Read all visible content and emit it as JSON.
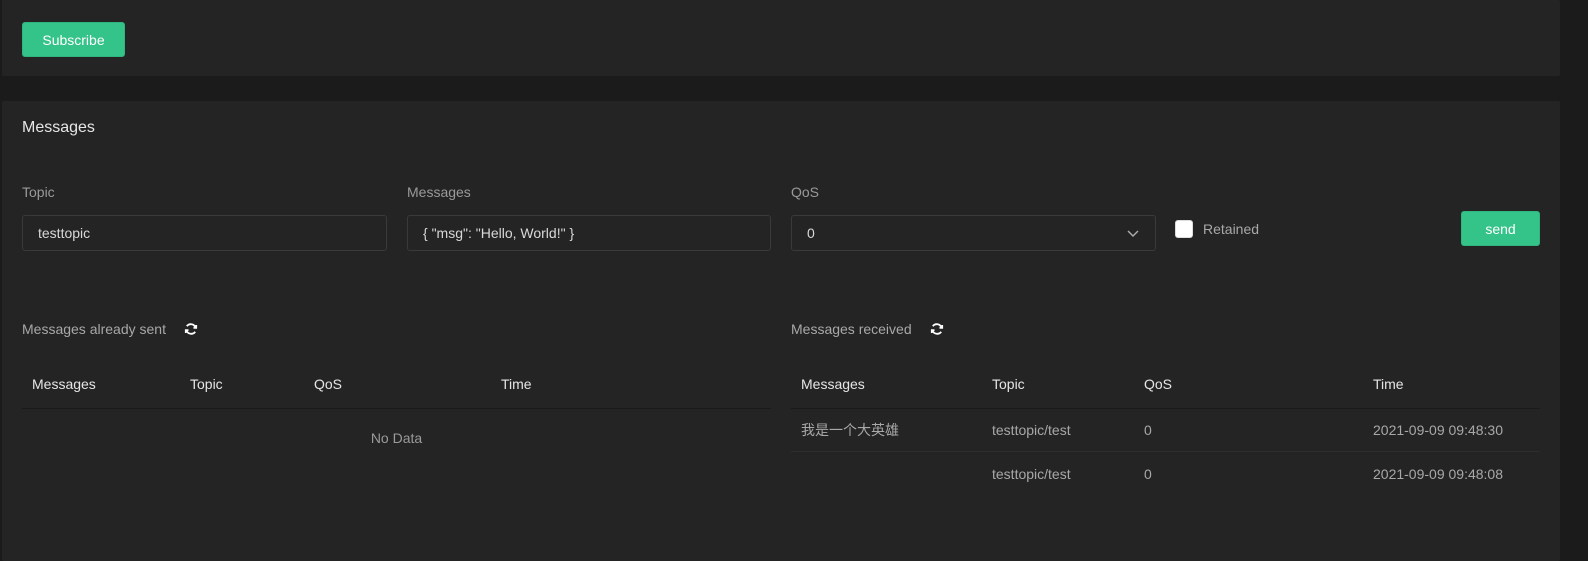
{
  "subscribe": {
    "button_label": "Subscribe"
  },
  "messages_panel": {
    "title": "Messages",
    "topic": {
      "label": "Topic",
      "value": "testtopic"
    },
    "messages": {
      "label": "Messages",
      "value": "{ \"msg\": \"Hello, World!\" }"
    },
    "qos": {
      "label": "QoS",
      "value": "0",
      "icon": "chevron-down-icon"
    },
    "retained": {
      "label": "Retained",
      "checked": false
    },
    "send_label": "send"
  },
  "sent": {
    "title": "Messages already sent",
    "icon": "refresh-icon",
    "columns": [
      "Messages",
      "Topic",
      "QoS",
      "Time"
    ],
    "empty_text": "No Data"
  },
  "received": {
    "title": "Messages received",
    "icon": "refresh-icon",
    "columns": [
      "Messages",
      "Topic",
      "QoS",
      "Time"
    ],
    "rows": [
      {
        "message": "我是一个大英雄",
        "topic": "testtopic/test",
        "qos": "0",
        "time": "2021-09-09 09:48:30"
      },
      {
        "message": "",
        "topic": "testtopic/test",
        "qos": "0",
        "time": "2021-09-09 09:48:08"
      }
    ]
  },
  "colors": {
    "accent": "#34c388",
    "background": "#1b1b1b",
    "card": "#242424"
  }
}
